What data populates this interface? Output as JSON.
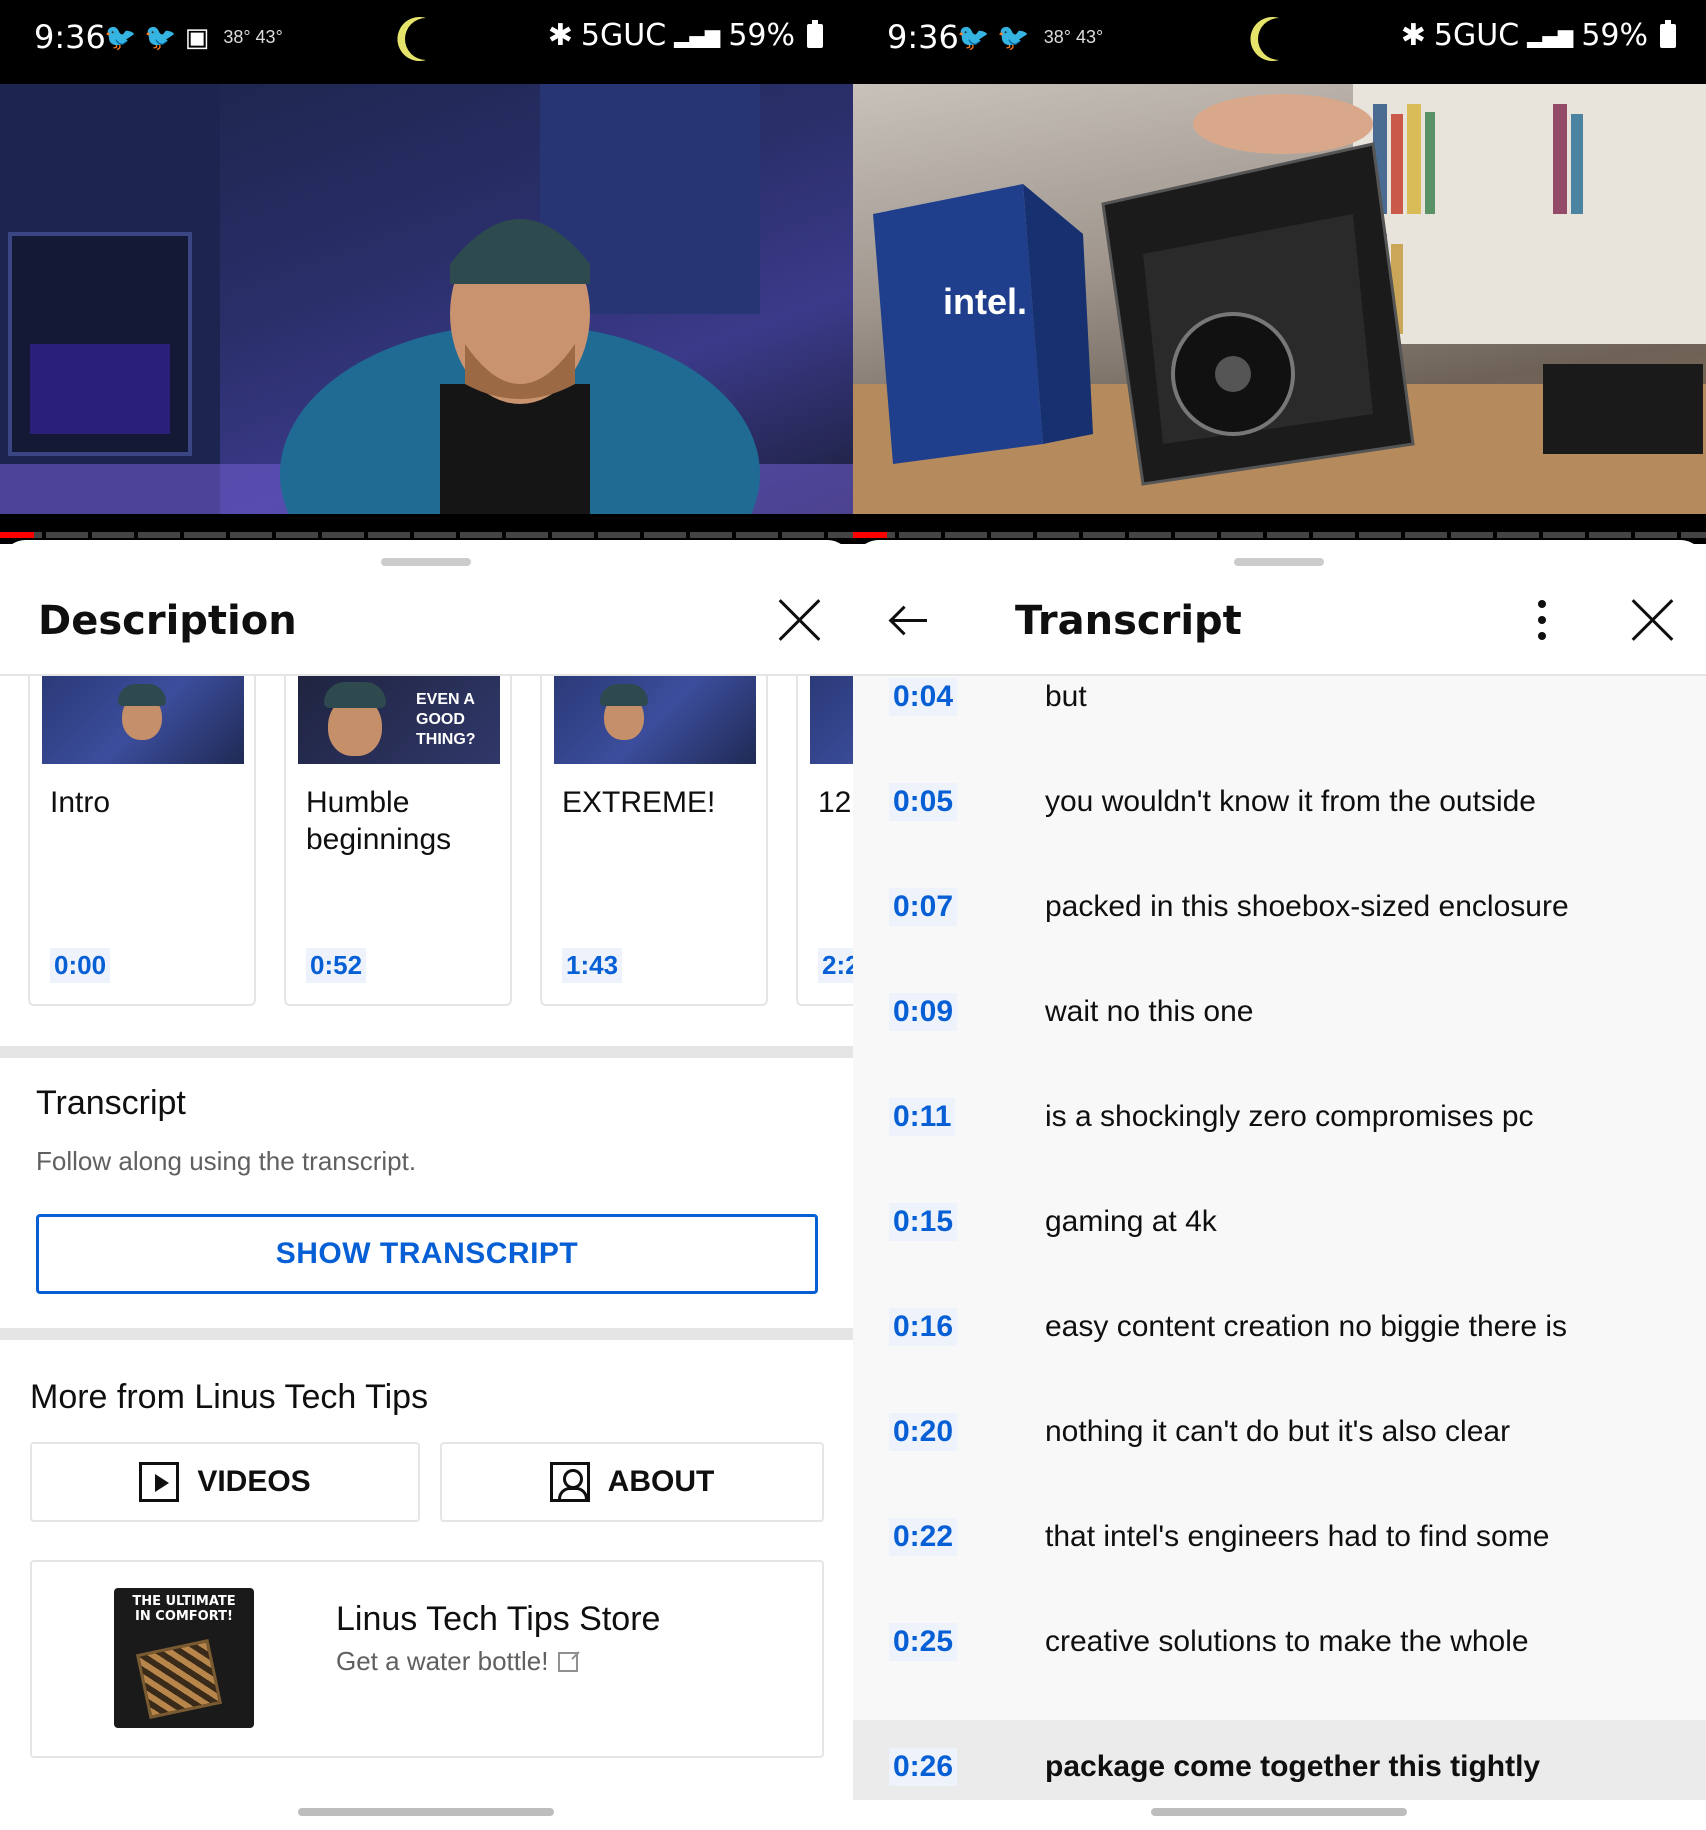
{
  "status_bar": {
    "time": "9:36",
    "temps": "38° 43°",
    "network": "5GUC",
    "battery": "59%"
  },
  "left": {
    "sheet_title": "Description",
    "chapters": [
      {
        "title": "Intro",
        "time": "0:00"
      },
      {
        "title": "Humble beginnings",
        "time": "0:52",
        "thumb_text": "EVEN A GOOD THING?"
      },
      {
        "title": "EXTREME!",
        "time": "1:43"
      },
      {
        "title": "12",
        "time": "2:2"
      }
    ],
    "transcript_section": {
      "title": "Transcript",
      "subtitle": "Follow along using the transcript.",
      "button": "SHOW TRANSCRIPT"
    },
    "more_section": {
      "title": "More from Linus Tech Tips",
      "videos_label": "VIDEOS",
      "about_label": "ABOUT"
    },
    "store": {
      "image_text": "THE ULTIMATE IN COMFORT!",
      "title": "Linus Tech Tips Store",
      "subtitle": "Get a water bottle!"
    }
  },
  "right": {
    "sheet_title": "Transcript",
    "video_overlay": "intel.",
    "rows": [
      {
        "time": "0:04",
        "text": "but"
      },
      {
        "time": "0:05",
        "text": "you wouldn't know it from the outside"
      },
      {
        "time": "0:07",
        "text": "packed in this shoebox-sized enclosure"
      },
      {
        "time": "0:09",
        "text": "wait no this one"
      },
      {
        "time": "0:11",
        "text": "is a shockingly zero compromises pc"
      },
      {
        "time": "0:15",
        "text": "gaming at 4k"
      },
      {
        "time": "0:16",
        "text": "easy content creation no biggie there is"
      },
      {
        "time": "0:20",
        "text": "nothing it can't do but it's also clear"
      },
      {
        "time": "0:22",
        "text": "that intel's engineers had to find some"
      },
      {
        "time": "0:25",
        "text": "creative solutions to make the whole"
      },
      {
        "time": "0:26",
        "text": "package come together this tightly",
        "active": true
      }
    ]
  },
  "colors": {
    "accent": "#065fd4",
    "progress": "#ff0000",
    "divider": "#e5e5e5",
    "active_row": "#ebebeb"
  },
  "progress": {
    "left_fraction": 0.04,
    "right_fraction": 0.04
  }
}
